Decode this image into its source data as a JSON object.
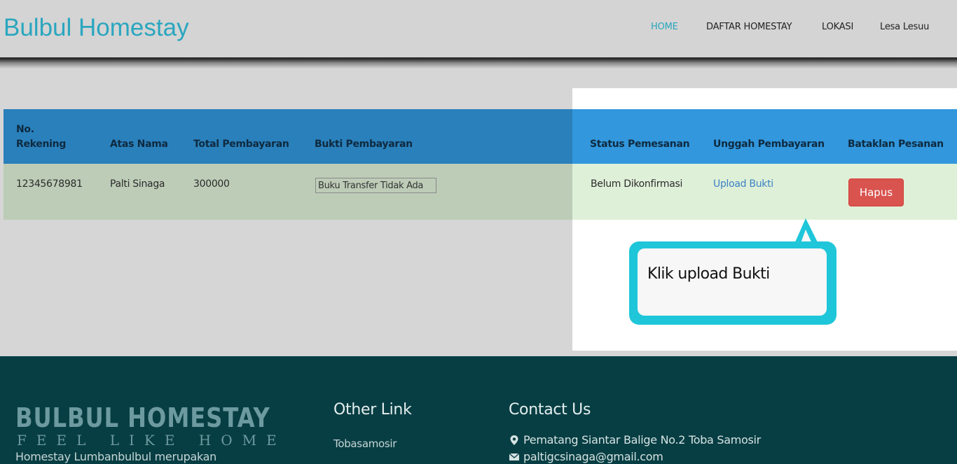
{
  "header": {
    "brand": "Bulbul Homestay",
    "nav": [
      {
        "label": "HOME",
        "active": true
      },
      {
        "label": "DAFTAR HOMESTAY",
        "active": false
      },
      {
        "label": "LOKASI",
        "active": false
      },
      {
        "label": "Lesa Lesuu",
        "active": false
      }
    ],
    "accent_color": "#2aa6bf"
  },
  "table": {
    "columns": {
      "no_rekening_line1": "No.",
      "no_rekening_line2": "Rekening",
      "atas_nama": "Atas Nama",
      "total_pembayaran": "Total Pembayaran",
      "bukti_pembayaran": "Bukti Pembayaran",
      "status_pemesanan": "Status Pemesanan",
      "unggah_pembayaran": "Unggah Pembayaran",
      "bataklan_pesanan": "Bataklan Pesanan"
    },
    "row": {
      "no_rekening": "12345678981",
      "atas_nama": "Palti Sinaga",
      "total_pembayaran": "300000",
      "bukti_pembayaran": "Buku Transfer Tidak Ada",
      "status_pemesanan": "Belum Dikonfirmasi",
      "upload_link": "Upload Bukti",
      "delete_button": "Hapus"
    },
    "header_color": "#3297dc",
    "row_color": "#dff0d8",
    "danger_color": "#d9534f"
  },
  "callout": {
    "text": "Klik upload Bukti",
    "color": "#1fc6d9"
  },
  "footer": {
    "logo": "BULBUL HOMESTAY",
    "tagline": "FEEL LIKE HOME",
    "description": "Homestay Lumbanbulbul merupakan",
    "other_link_heading": "Other Link",
    "other_links": [
      "Tobasamosir"
    ],
    "contact_heading": "Contact Us",
    "address": "Pematang Siantar Balige No.2 Toba Samosir",
    "email": "paltigcsinaga@gmail.com",
    "background": "#073e43",
    "icons": [
      "map-marker-icon",
      "envelope-icon"
    ]
  }
}
